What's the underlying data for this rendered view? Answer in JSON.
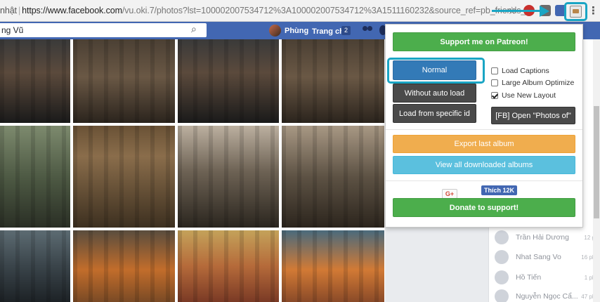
{
  "browser": {
    "security_text": "nhật",
    "url_host": "https://www.facebook.com",
    "url_path": "/vu.oki.7/photos?lst=100002007534712%3A100002007534712%3A1511160232&source_ref=pb_friends_tl"
  },
  "facebook": {
    "search_value": "ng Vũ",
    "user_name": "Phùng",
    "home_label": "Trang chủ",
    "home_badge": "2"
  },
  "popup": {
    "patreon_label": "Support me on Patreon!",
    "normal_label": "Normal",
    "without_auto_load_label": "Without auto load",
    "load_from_id_label": "Load from specific id",
    "load_captions_label": "Load Captions",
    "large_album_label": "Large Album Optimize",
    "new_layout_label": "Use New Layout",
    "open_photos_of_label": "[FB] Open \"Photos of\"",
    "export_last_label": "Export last album",
    "view_downloaded_label": "View all downloaded albums",
    "gplus_label": "G+",
    "fb_like_label": "Thích 12K",
    "donate_label": "Donate to support!",
    "load_captions_checked": false,
    "large_album_checked": false,
    "new_layout_checked": true
  },
  "sidebar": {
    "contacts": [
      {
        "name": "Trần Hải Dương",
        "time": "12 giờ"
      },
      {
        "name": "Nhat Sang Vo",
        "time": "16 phút"
      },
      {
        "name": "Hồ Tiến",
        "time": "1 phút"
      },
      {
        "name": "Nguyễn Ngọc Cẩ...",
        "time": "47 phút"
      }
    ]
  },
  "colors": {
    "highlight": "#1aa5c4",
    "fb_blue": "#4267b2",
    "green": "#4cae4c",
    "primary": "#337ab7",
    "warning": "#f0ad4e",
    "info": "#5bc0de"
  }
}
